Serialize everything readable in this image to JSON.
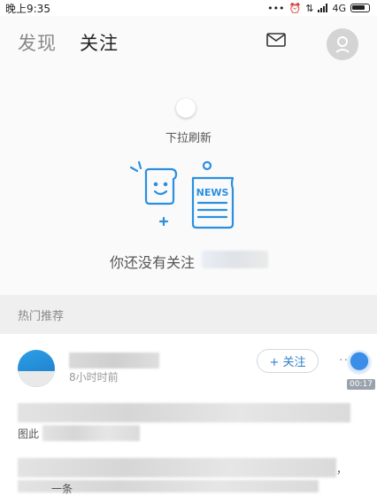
{
  "status_bar": {
    "time": "晚上9:35",
    "network": "4G"
  },
  "header": {
    "tabs": [
      {
        "label": "发现"
      },
      {
        "label": "关注"
      }
    ]
  },
  "empty_state": {
    "pull_refresh": "下拉刷新",
    "illustration_label": "NEWS",
    "message": "你还没有关注"
  },
  "section": {
    "title": "热门推荐"
  },
  "feed": {
    "time": "8小时时前",
    "follow_label": "+ 关注",
    "more": "···",
    "duration": "00:17",
    "fragments": [
      "图此",
      "，",
      "一条"
    ]
  },
  "colors": {
    "accent": "#2f7fc8",
    "illustration": "#2b8fe0"
  }
}
